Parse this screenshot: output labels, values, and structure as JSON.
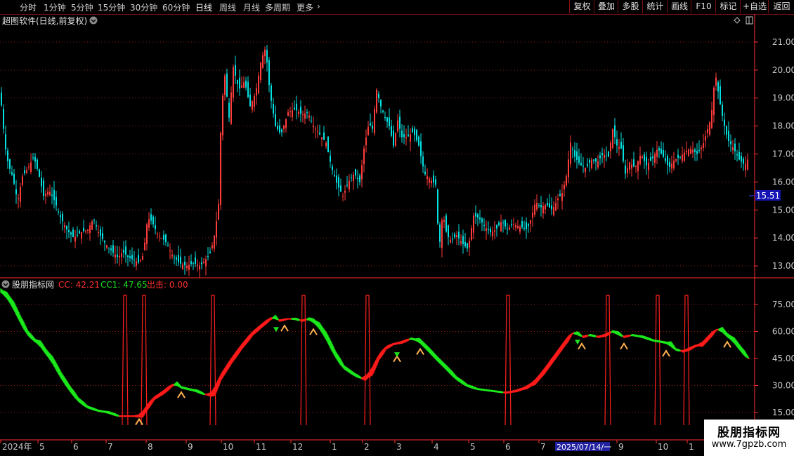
{
  "toolbar": {
    "items": [
      "分时",
      "1分钟",
      "5分钟",
      "15分钟",
      "30分钟",
      "60分钟",
      "日线",
      "周线",
      "月线",
      "多周期",
      "更多"
    ],
    "active_index": 6,
    "more_arrow": "›",
    "right": [
      "复权",
      "叠加",
      "多股",
      "统计",
      "画线",
      "F10",
      "标记",
      "+自选",
      "返回"
    ]
  },
  "main_panel": {
    "title": "超图软件(日线,前复权)",
    "current_price": "15.51",
    "price_ticks": [
      "21.00",
      "20.00",
      "19.00",
      "18.00",
      "17.00",
      "16.00",
      "15.00",
      "14.00",
      "13.00"
    ]
  },
  "indicator_panel": {
    "name": "股朋指标网",
    "cc_label": "CC: 42.21",
    "cc1_label": "CC1: 47.65",
    "out_label": "出击: 0.00",
    "ticks": [
      "75.00",
      "60.00",
      "45.00",
      "30.00",
      "15.00"
    ]
  },
  "time_axis": {
    "labels": [
      "2024年",
      "5",
      "6",
      "7",
      "8",
      "9",
      "10",
      "11",
      "12",
      "1",
      "2",
      "3",
      "4",
      "5",
      "6",
      "7",
      "2025/07/14/一",
      "9",
      "10",
      "1"
    ]
  },
  "watermark": {
    "line1": "股朋指标网",
    "line2": "www.7gpzb.com"
  },
  "colors": {
    "up": "#ff3c3c",
    "down": "#00e0e0",
    "red": "#ff1a1a",
    "green": "#1ae81a",
    "grid": "#8b1a1a",
    "axis": "#ff3030"
  },
  "chart_data": [
    {
      "type": "candlestick",
      "title": "超图软件(日线,前复权)",
      "ylim": [
        12.5,
        21.5
      ],
      "x_range": [
        "2024-04",
        "2025-10"
      ],
      "close_path": [
        [
          0,
          19.2
        ],
        [
          3,
          18.5
        ],
        [
          7,
          17.3
        ],
        [
          12,
          16.6
        ],
        [
          18,
          16.2
        ],
        [
          25,
          15.3
        ],
        [
          32,
          16.2
        ],
        [
          40,
          16.5
        ],
        [
          48,
          16.9
        ],
        [
          55,
          16.3
        ],
        [
          62,
          15.5
        ],
        [
          70,
          15.7
        ],
        [
          78,
          15.3
        ],
        [
          85,
          14.8
        ],
        [
          95,
          14.3
        ],
        [
          105,
          14.0
        ],
        [
          115,
          14.2
        ],
        [
          125,
          14.3
        ],
        [
          133,
          14.7
        ],
        [
          140,
          14.2
        ],
        [
          150,
          13.8
        ],
        [
          160,
          13.5
        ],
        [
          168,
          13.3
        ],
        [
          175,
          13.5
        ],
        [
          183,
          13.3
        ],
        [
          192,
          13.2
        ],
        [
          198,
          13.1
        ],
        [
          204,
          13.4
        ],
        [
          210,
          14.7
        ],
        [
          216,
          14.6
        ],
        [
          225,
          14.1
        ],
        [
          235,
          13.9
        ],
        [
          245,
          13.4
        ],
        [
          255,
          13.1
        ],
        [
          265,
          13.0
        ],
        [
          275,
          13.1
        ],
        [
          285,
          13.0
        ],
        [
          292,
          13.2
        ],
        [
          300,
          13.5
        ],
        [
          306,
          14.2
        ],
        [
          311,
          15.2
        ],
        [
          315,
          18.6
        ],
        [
          320,
          19.8
        ],
        [
          326,
          18.3
        ],
        [
          332,
          20.1
        ],
        [
          340,
          19.3
        ],
        [
          348,
          19.6
        ],
        [
          356,
          18.7
        ],
        [
          364,
          19.2
        ],
        [
          372,
          20.4
        ],
        [
          378,
          20.8
        ],
        [
          384,
          19.2
        ],
        [
          392,
          18.0
        ],
        [
          400,
          17.7
        ],
        [
          410,
          18.5
        ],
        [
          420,
          18.6
        ],
        [
          430,
          18.4
        ],
        [
          438,
          18.5
        ],
        [
          446,
          18.0
        ],
        [
          455,
          17.7
        ],
        [
          464,
          17.4
        ],
        [
          472,
          16.5
        ],
        [
          480,
          15.9
        ],
        [
          488,
          15.5
        ],
        [
          496,
          16.0
        ],
        [
          504,
          16.3
        ],
        [
          512,
          16.0
        ],
        [
          518,
          17.2
        ],
        [
          525,
          18.1
        ],
        [
          530,
          17.9
        ],
        [
          536,
          19.3
        ],
        [
          542,
          18.7
        ],
        [
          548,
          18.3
        ],
        [
          554,
          18.0
        ],
        [
          560,
          17.3
        ],
        [
          566,
          18.2
        ],
        [
          572,
          17.6
        ],
        [
          580,
          17.6
        ],
        [
          588,
          17.8
        ],
        [
          596,
          17.3
        ],
        [
          604,
          16.3
        ],
        [
          612,
          16.1
        ],
        [
          620,
          15.9
        ],
        [
          625,
          13.6
        ],
        [
          630,
          14.9
        ],
        [
          636,
          14.1
        ],
        [
          642,
          13.9
        ],
        [
          650,
          14.1
        ],
        [
          658,
          13.8
        ],
        [
          666,
          13.6
        ],
        [
          674,
          14.8
        ],
        [
          682,
          14.7
        ],
        [
          690,
          14.4
        ],
        [
          698,
          14.2
        ],
        [
          706,
          14.3
        ],
        [
          714,
          14.6
        ],
        [
          722,
          14.3
        ],
        [
          730,
          14.5
        ],
        [
          740,
          14.4
        ],
        [
          750,
          14.3
        ],
        [
          756,
          14.7
        ],
        [
          762,
          15.3
        ],
        [
          770,
          15.1
        ],
        [
          778,
          15.2
        ],
        [
          786,
          15.0
        ],
        [
          794,
          15.4
        ],
        [
          800,
          15.6
        ],
        [
          806,
          16.2
        ],
        [
          812,
          17.4
        ],
        [
          818,
          16.9
        ],
        [
          826,
          16.6
        ],
        [
          834,
          16.5
        ],
        [
          842,
          16.8
        ],
        [
          850,
          16.7
        ],
        [
          858,
          17.0
        ],
        [
          866,
          16.9
        ],
        [
          872,
          17.9
        ],
        [
          878,
          17.3
        ],
        [
          884,
          17.2
        ],
        [
          890,
          16.3
        ],
        [
          896,
          16.7
        ],
        [
          904,
          16.5
        ],
        [
          912,
          17.0
        ],
        [
          920,
          16.6
        ],
        [
          928,
          16.8
        ],
        [
          936,
          17.2
        ],
        [
          944,
          16.9
        ],
        [
          952,
          16.5
        ],
        [
          960,
          16.8
        ],
        [
          968,
          16.9
        ],
        [
          976,
          17.1
        ],
        [
          984,
          17.2
        ],
        [
          992,
          17.0
        ],
        [
          1000,
          17.3
        ],
        [
          1006,
          17.8
        ],
        [
          1012,
          18.3
        ],
        [
          1018,
          19.9
        ],
        [
          1024,
          18.9
        ],
        [
          1030,
          18.1
        ],
        [
          1036,
          17.5
        ],
        [
          1044,
          17.2
        ],
        [
          1052,
          16.8
        ],
        [
          1060,
          16.6
        ],
        [
          1066,
          16.9
        ]
      ],
      "last_close": 15.51
    },
    {
      "type": "area",
      "title": "股朋指标网",
      "ylim": [
        8,
        85
      ],
      "series": [
        {
          "name": "CC",
          "value": 42.21
        },
        {
          "name": "CC1",
          "value": 47.65
        },
        {
          "name": "出击",
          "value": 0.0
        }
      ],
      "cc_path": [
        [
          0,
          83
        ],
        [
          10,
          80
        ],
        [
          20,
          74
        ],
        [
          30,
          66
        ],
        [
          40,
          59
        ],
        [
          50,
          55
        ],
        [
          58,
          53
        ],
        [
          65,
          49
        ],
        [
          75,
          44
        ],
        [
          88,
          35
        ],
        [
          100,
          28
        ],
        [
          112,
          22
        ],
        [
          125,
          18
        ],
        [
          140,
          16
        ],
        [
          155,
          15
        ],
        [
          170,
          13
        ],
        [
          185,
          13
        ],
        [
          196,
          13
        ],
        [
          203,
          14
        ],
        [
          210,
          18
        ],
        [
          220,
          23
        ],
        [
          232,
          26
        ],
        [
          245,
          30
        ],
        [
          252,
          31
        ],
        [
          258,
          29
        ],
        [
          268,
          28
        ],
        [
          280,
          27
        ],
        [
          292,
          25
        ],
        [
          300,
          25
        ],
        [
          306,
          27
        ],
        [
          315,
          35
        ],
        [
          330,
          44
        ],
        [
          345,
          52
        ],
        [
          360,
          59
        ],
        [
          375,
          64
        ],
        [
          385,
          67
        ],
        [
          392,
          68
        ],
        [
          398,
          66
        ],
        [
          410,
          67
        ],
        [
          420,
          67
        ],
        [
          430,
          66
        ],
        [
          440,
          67
        ],
        [
          446,
          66
        ],
        [
          455,
          63
        ],
        [
          465,
          57
        ],
        [
          478,
          47
        ],
        [
          490,
          40
        ],
        [
          505,
          36
        ],
        [
          515,
          34
        ],
        [
          520,
          34
        ],
        [
          530,
          38
        ],
        [
          540,
          46
        ],
        [
          550,
          51
        ],
        [
          560,
          53
        ],
        [
          572,
          54
        ],
        [
          585,
          56
        ],
        [
          597,
          55
        ],
        [
          610,
          50
        ],
        [
          622,
          45
        ],
        [
          635,
          40
        ],
        [
          650,
          34
        ],
        [
          665,
          30
        ],
        [
          680,
          28
        ],
        [
          700,
          27
        ],
        [
          720,
          26
        ],
        [
          735,
          27
        ],
        [
          750,
          29
        ],
        [
          762,
          32
        ],
        [
          775,
          38
        ],
        [
          790,
          46
        ],
        [
          805,
          54
        ],
        [
          815,
          59
        ],
        [
          822,
          59
        ],
        [
          830,
          57
        ],
        [
          840,
          58
        ],
        [
          852,
          57
        ],
        [
          862,
          58
        ],
        [
          872,
          60
        ],
        [
          880,
          59
        ],
        [
          888,
          57
        ],
        [
          900,
          58
        ],
        [
          915,
          57
        ],
        [
          930,
          55
        ],
        [
          945,
          54
        ],
        [
          955,
          53
        ],
        [
          962,
          50
        ],
        [
          972,
          49
        ],
        [
          980,
          50
        ],
        [
          990,
          52
        ],
        [
          1000,
          53
        ],
        [
          1012,
          58
        ],
        [
          1020,
          61
        ],
        [
          1028,
          61
        ],
        [
          1035,
          58
        ],
        [
          1045,
          55
        ],
        [
          1055,
          50
        ],
        [
          1066,
          45
        ]
      ],
      "signal_x": [
        178,
        205,
        303,
        432,
        523,
        723,
        865,
        936,
        977
      ]
    }
  ]
}
